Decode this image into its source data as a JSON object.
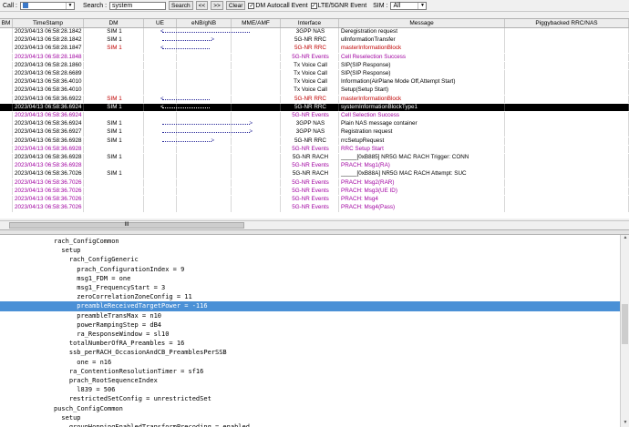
{
  "toolbar": {
    "call_label": "Call :",
    "call_value": "",
    "search_label": "Search :",
    "search_value": "system",
    "search_button": "Search",
    "prev_button": "<<",
    "next_button": ">>",
    "clear_button": "Clear",
    "dm_autocall_label": "DM Autocall Event",
    "dm_autocall_checked": true,
    "lte_event_label": "LTE/5GNR Event",
    "lte_event_checked": true,
    "sim_label": "SIM :",
    "sim_value": "All"
  },
  "table": {
    "columns": [
      "BM",
      "TimeStamp",
      "DM",
      "UE",
      "eNB/gNB",
      "MME/AMF",
      "Interface",
      "Message",
      "Piggybacked RRC/NAS"
    ],
    "rows": [
      {
        "ts": "2023/04/13 06:58:28.1842",
        "dm": "SIM 1",
        "arrow": "l",
        "iface": "3GPP NAS",
        "msg": "Deregistration request",
        "color": "#000000"
      },
      {
        "ts": "2023/04/13 06:58:28.1842",
        "dm": "SIM 1",
        "arrow": "r",
        "iface": "5G-NR RRC",
        "msg": "ulInformationTransfer",
        "color": "#000000"
      },
      {
        "ts": "2023/04/13 06:58:28.1847",
        "dm": "SIM 1",
        "arrow": "l",
        "iface": "5G-NR RRC",
        "msg": "masterInformationBlock",
        "color": "#c00000"
      },
      {
        "ts": "2023/04/13 06:58:28.1848",
        "dm": "",
        "arrow": "",
        "iface": "5G-NR Events",
        "msg": "Cell Reselection Success",
        "color": "#a000a0"
      },
      {
        "ts": "2023/04/13 06:58:28.1860",
        "dm": "",
        "arrow": "",
        "iface": "Tx Voice Call",
        "msg": "SIP(SIP Response)",
        "color": "#000000"
      },
      {
        "ts": "2023/04/13 06:58:28.6689",
        "dm": "",
        "arrow": "",
        "iface": "Tx Voice Call",
        "msg": "SIP(SIP Response)",
        "color": "#000000"
      },
      {
        "ts": "2023/04/13 06:58:36.4010",
        "dm": "",
        "arrow": "",
        "iface": "Tx Voice Call",
        "msg": "Information(AirPlane Mode Off,Attempt Start)",
        "color": "#000000"
      },
      {
        "ts": "2023/04/13 06:58:36.4010",
        "dm": "",
        "arrow": "",
        "iface": "Tx Voice Call",
        "msg": "Setup(Setup Start)",
        "color": "#000000"
      },
      {
        "ts": "2023/04/13 06:58:36.6922",
        "dm": "SIM 1",
        "arrow": "l",
        "iface": "5G-NR RRC",
        "msg": "masterInformationBlock",
        "color": "#c00000"
      },
      {
        "ts": "2023/04/13 06:58:36.6924",
        "dm": "SIM 1",
        "arrow": "l",
        "iface": "5G-NR RRC",
        "msg": "systemInformationBlockType1",
        "color": "#ffffff",
        "selected": true
      },
      {
        "ts": "2023/04/13 06:58:36.6924",
        "dm": "",
        "arrow": "",
        "iface": "5G-NR Events",
        "msg": "Cell Selection Success",
        "color": "#a000a0"
      },
      {
        "ts": "2023/04/13 06:58:36.6924",
        "dm": "SIM 1",
        "arrow": "r",
        "iface": "3GPP NAS",
        "msg": "Plain NAS message container",
        "color": "#000000"
      },
      {
        "ts": "2023/04/13 06:58:36.6927",
        "dm": "SIM 1",
        "arrow": "r",
        "iface": "3GPP NAS",
        "msg": "Registration request",
        "color": "#000000"
      },
      {
        "ts": "2023/04/13 06:58:36.6928",
        "dm": "SIM 1",
        "arrow": "r",
        "iface": "5G-NR RRC",
        "msg": "rrcSetupRequest",
        "color": "#000000"
      },
      {
        "ts": "2023/04/13 06:58:36.6928",
        "dm": "",
        "arrow": "",
        "iface": "5G-NR Events",
        "msg": "RRC Setup Start",
        "color": "#a000a0"
      },
      {
        "ts": "2023/04/13 06:58:36.6928",
        "dm": "SIM 1",
        "arrow": "",
        "iface": "5G-NR RACH",
        "msg": "_____[0xB885] NR5G MAC RACH Trigger: CONN",
        "color": "#000000"
      },
      {
        "ts": "2023/04/13 06:58:36.6928",
        "dm": "",
        "arrow": "",
        "iface": "5G-NR Events",
        "msg": "PRACH: Msg1(RA)",
        "color": "#a000a0"
      },
      {
        "ts": "2023/04/13 06:58:36.7026",
        "dm": "SIM 1",
        "arrow": "",
        "iface": "5G-NR RACH",
        "msg": "_____[0xB88A] NR5G MAC RACH Attempt: SUC",
        "color": "#000000"
      },
      {
        "ts": "2023/04/13 06:58:36.7026",
        "dm": "",
        "arrow": "",
        "iface": "5G-NR Events",
        "msg": "PRACH: Msg2(RAR)",
        "color": "#a000a0"
      },
      {
        "ts": "2023/04/13 06:58:36.7026",
        "dm": "",
        "arrow": "",
        "iface": "5G-NR Events",
        "msg": "PRACH: Msg3(UE ID)",
        "color": "#a000a0"
      },
      {
        "ts": "2023/04/13 06:58:36.7026",
        "dm": "",
        "arrow": "",
        "iface": "5G-NR Events",
        "msg": "PRACH: Msg4",
        "color": "#a000a0"
      },
      {
        "ts": "2023/04/13 06:58:36.7026",
        "dm": "",
        "arrow": "",
        "iface": "5G-NR Events",
        "msg": "PRACH: Msg4(Pass)",
        "color": "#a000a0"
      }
    ],
    "row_ts_colors": {
      "event": "#a000a0",
      "normal": "#000000"
    }
  },
  "scroll_grip": "III",
  "detail": {
    "highlight_index": 7,
    "lines": [
      "              rach_ConfigCommon",
      "                setup",
      "                  rach_ConfigGeneric",
      "                    prach_ConfigurationIndex = 9",
      "                    msg1_FDM = one",
      "                    msg1_FrequencyStart = 3",
      "                    zeroCorrelationZoneConfig = 11",
      "                    preambleReceivedTargetPower = -116",
      "                    preambleTransMax = n10",
      "                    powerRampingStep = dB4",
      "                    ra_ResponseWindow = sl10",
      "                  totalNumberOfRA_Preambles = 16",
      "                  ssb_perRACH_OccasionAndCB_PreamblesPerSSB",
      "                    one = n16",
      "                  ra_ContentionResolutionTimer = sf16",
      "                  prach_RootSequenceIndex",
      "                    l839 = 506",
      "                  restrictedSetConfig = unrestrictedSet",
      "              pusch_ConfigCommon",
      "                setup",
      "                  groupHoppingEnabledTransformPrecoding = enabled"
    ]
  }
}
